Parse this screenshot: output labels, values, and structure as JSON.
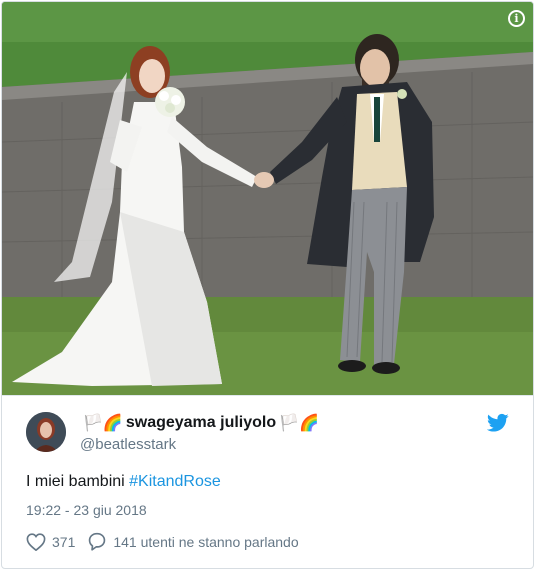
{
  "tweet": {
    "display_name": "swageyama juliyolo",
    "handle": "@beatlesstark",
    "text_prefix": "I miei bambini ",
    "hashtag": "#KitandRose",
    "timestamp": "19:22 - 23 giu 2018",
    "likes": "371",
    "conversation": "141 utenti ne stanno parlando",
    "flag_left": "🏳️🌈",
    "flag_right": "🏳️🌈"
  },
  "icons": {
    "info": "info-icon",
    "twitter": "twitter-bird-icon",
    "like": "heart-outline-icon",
    "reply": "speech-bubble-icon"
  },
  "colors": {
    "link": "#1b95e0",
    "secondary": "#657786",
    "text": "#14171a"
  }
}
